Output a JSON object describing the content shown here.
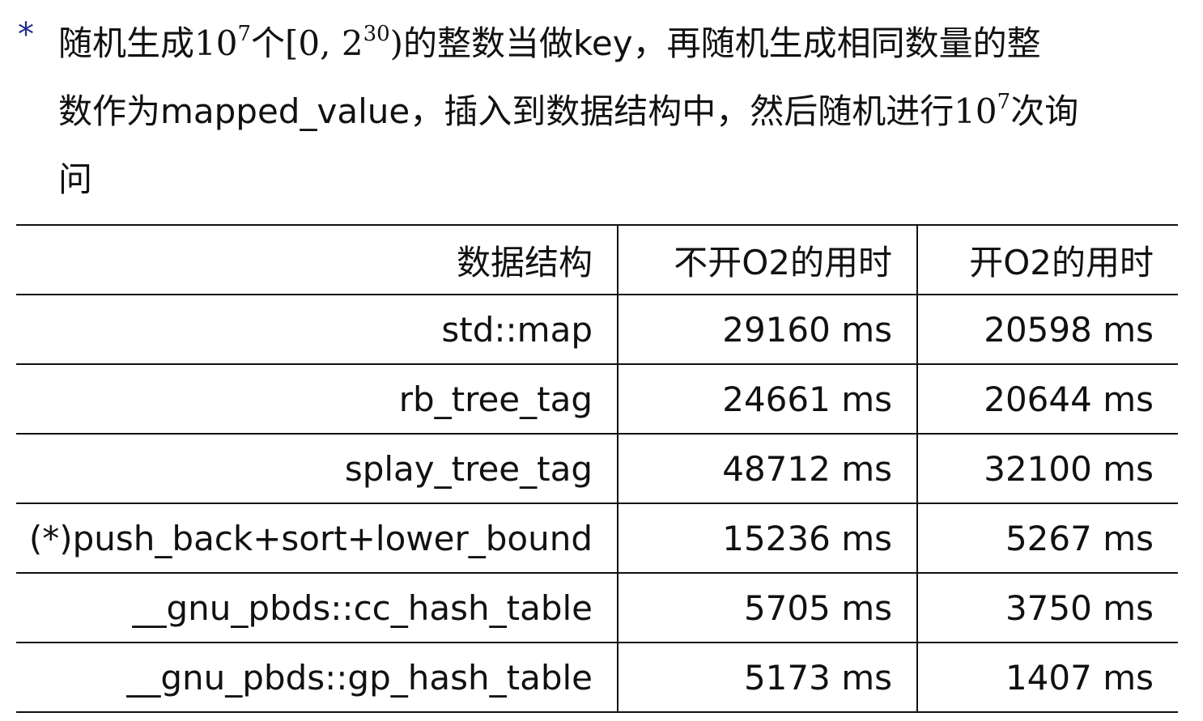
{
  "bullet": {
    "marker": "*",
    "line1": {
      "t1": "随机生成",
      "m1": "10",
      "e1": "7",
      "t2": "个",
      "m2": "[0, 2",
      "e2": "30",
      "m3": ")",
      "t3": "的整数当做key，再随机生成相同数量的整"
    },
    "line2": {
      "t1": "数作为mapped_value，插入到数据结构中，然后随机进行",
      "m1": "10",
      "e1": "7",
      "t2": "次询"
    },
    "line3": {
      "t1": "问"
    }
  },
  "table": {
    "headers": [
      "数据结构",
      "不开O2的用时",
      "开O2的用时"
    ],
    "rows": [
      {
        "structure": "std::map",
        "no_o2": "29160 ms",
        "o2": "20598 ms"
      },
      {
        "structure": "rb_tree_tag",
        "no_o2": "24661 ms",
        "o2": "20644 ms"
      },
      {
        "structure": "splay_tree_tag",
        "no_o2": "48712 ms",
        "o2": "32100 ms"
      },
      {
        "structure": "(*)push_back+sort+lower_bound",
        "no_o2": "15236 ms",
        "o2": "5267 ms"
      },
      {
        "structure": "__gnu_pbds::cc_hash_table",
        "no_o2": "5705 ms",
        "o2": "3750 ms"
      },
      {
        "structure": "__gnu_pbds::gp_hash_table",
        "no_o2": "5173 ms",
        "o2": "1407 ms"
      }
    ]
  }
}
